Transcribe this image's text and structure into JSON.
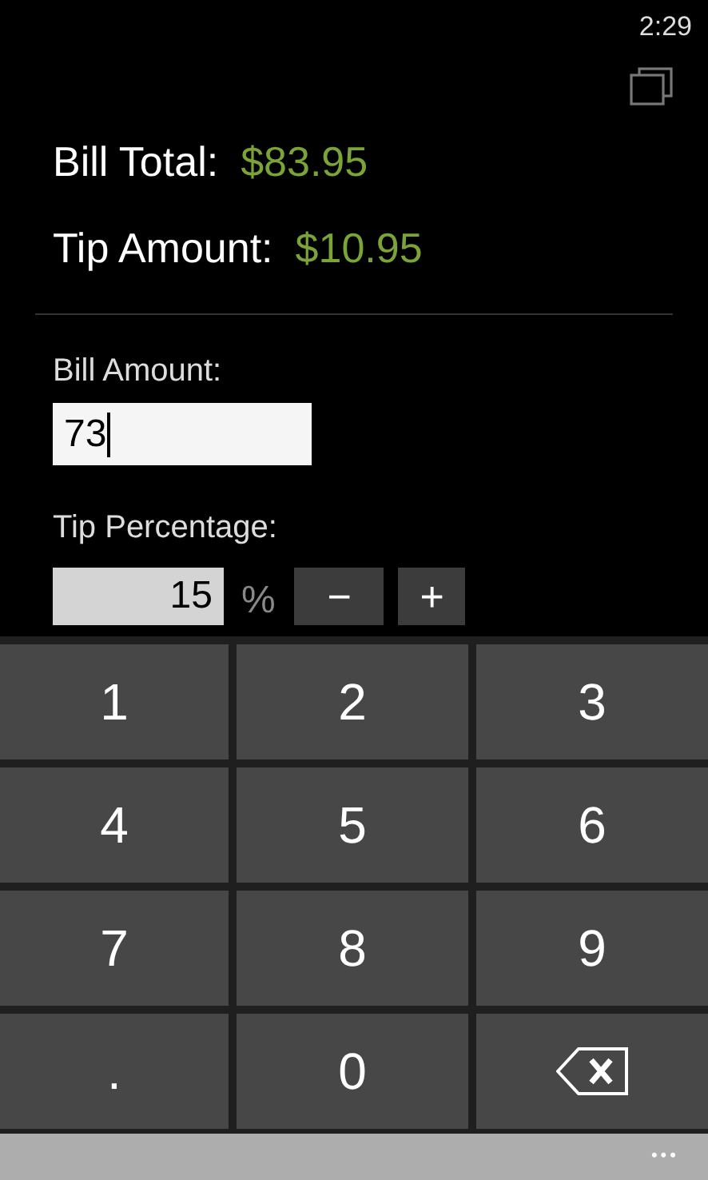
{
  "status_bar": {
    "time": "2:29"
  },
  "summary": [
    {
      "label": "Bill Total:",
      "value": "$83.95"
    },
    {
      "label": "Tip Amount:",
      "value": "$10.95"
    }
  ],
  "bill_amount": {
    "label": "Bill Amount:",
    "value": "73",
    "focused": true
  },
  "tip_percentage": {
    "label": "Tip Percentage:",
    "value": "15",
    "focused": false,
    "unit": "%",
    "decrement": "−",
    "increment": "+"
  },
  "keypad": [
    {
      "kind": "key",
      "label": "1"
    },
    {
      "kind": "key",
      "label": "2"
    },
    {
      "kind": "key",
      "label": "3"
    },
    {
      "kind": "key",
      "label": "4"
    },
    {
      "kind": "key",
      "label": "5"
    },
    {
      "kind": "key",
      "label": "6"
    },
    {
      "kind": "key",
      "label": "7"
    },
    {
      "kind": "key",
      "label": "8"
    },
    {
      "kind": "key",
      "label": "9"
    },
    {
      "kind": "key",
      "label": "."
    },
    {
      "kind": "key",
      "label": "0"
    },
    {
      "kind": "backspace"
    }
  ],
  "app_bar": {
    "more": "•••"
  }
}
